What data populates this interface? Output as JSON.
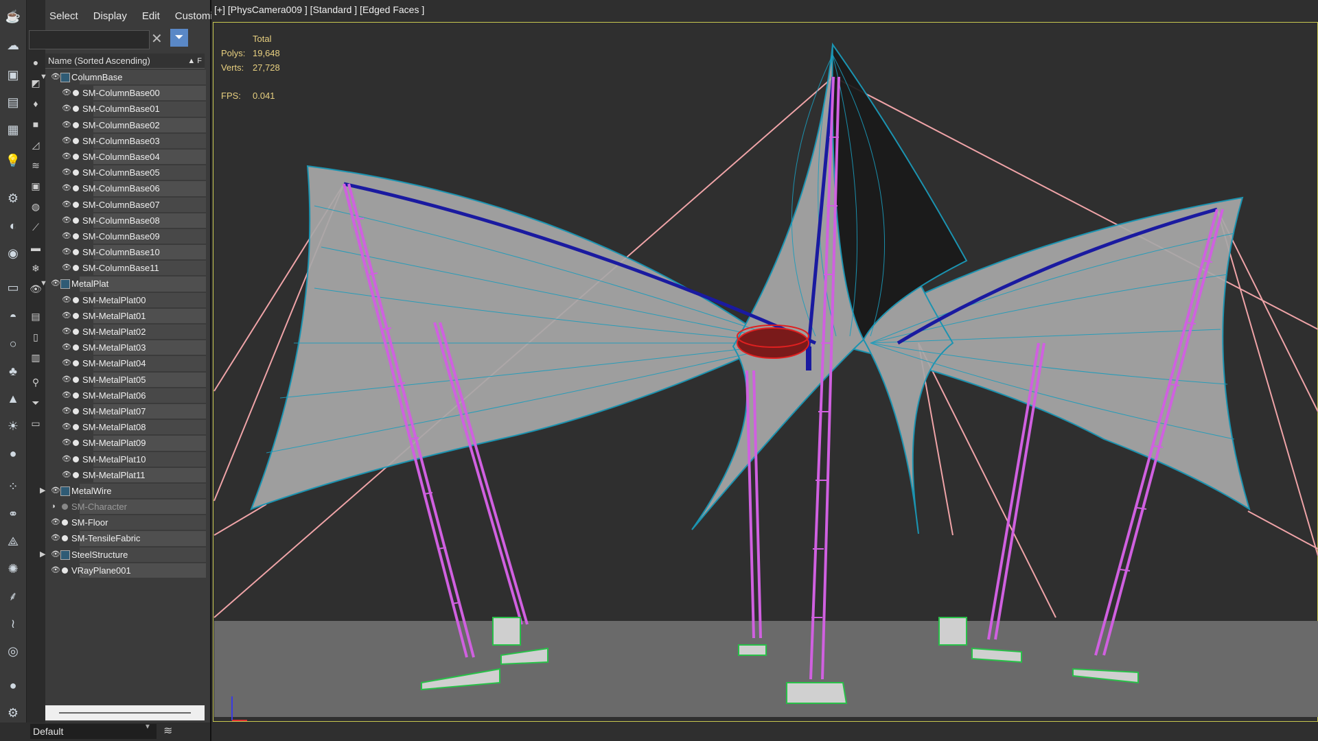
{
  "menu": [
    "Select",
    "Display",
    "Edit",
    "Customize"
  ],
  "search": {
    "placeholder": ""
  },
  "column_header": "Name (Sorted Ascending)",
  "column_header_extra": "F",
  "scene_items": [
    {
      "label": "ColumnBase",
      "type": "group",
      "expanded": true
    },
    {
      "label": "SM-ColumnBase00",
      "type": "child"
    },
    {
      "label": "SM-ColumnBase01",
      "type": "child"
    },
    {
      "label": "SM-ColumnBase02",
      "type": "child"
    },
    {
      "label": "SM-ColumnBase03",
      "type": "child"
    },
    {
      "label": "SM-ColumnBase04",
      "type": "child"
    },
    {
      "label": "SM-ColumnBase05",
      "type": "child"
    },
    {
      "label": "SM-ColumnBase06",
      "type": "child"
    },
    {
      "label": "SM-ColumnBase07",
      "type": "child"
    },
    {
      "label": "SM-ColumnBase08",
      "type": "child"
    },
    {
      "label": "SM-ColumnBase09",
      "type": "child"
    },
    {
      "label": "SM-ColumnBase10",
      "type": "child"
    },
    {
      "label": "SM-ColumnBase11",
      "type": "child"
    },
    {
      "label": "MetalPlat",
      "type": "group",
      "expanded": true
    },
    {
      "label": "SM-MetalPlat00",
      "type": "child"
    },
    {
      "label": "SM-MetalPlat01",
      "type": "child"
    },
    {
      "label": "SM-MetalPlat02",
      "type": "child"
    },
    {
      "label": "SM-MetalPlat03",
      "type": "child"
    },
    {
      "label": "SM-MetalPlat04",
      "type": "child"
    },
    {
      "label": "SM-MetalPlat05",
      "type": "child"
    },
    {
      "label": "SM-MetalPlat06",
      "type": "child"
    },
    {
      "label": "SM-MetalPlat07",
      "type": "child"
    },
    {
      "label": "SM-MetalPlat08",
      "type": "child"
    },
    {
      "label": "SM-MetalPlat09",
      "type": "child"
    },
    {
      "label": "SM-MetalPlat10",
      "type": "child"
    },
    {
      "label": "SM-MetalPlat11",
      "type": "child"
    },
    {
      "label": "MetalWire",
      "type": "group",
      "expanded": false
    },
    {
      "label": "SM-Character",
      "type": "object",
      "hidden": true
    },
    {
      "label": "SM-Floor",
      "type": "object"
    },
    {
      "label": "SM-TensileFabric",
      "type": "object"
    },
    {
      "label": "SteelStructure",
      "type": "group",
      "expanded": false
    },
    {
      "label": "VRayPlane001",
      "type": "object"
    }
  ],
  "layer": "Default",
  "viewport": {
    "label": "[+] [PhysCamera009 ] [Standard ] [Edged Faces ]",
    "stats_title": "Total",
    "polys_label": "Polys:",
    "polys": "19,648",
    "verts_label": "Verts:",
    "verts": "27,728",
    "fps_label": "FPS:",
    "fps": "0.041"
  },
  "colors": {
    "fabric_wire": "#1aa0c0",
    "columns": "#d060e0",
    "cables": "#f0a0a0",
    "edges": "#1a1aa0",
    "bases": "#28c048"
  }
}
